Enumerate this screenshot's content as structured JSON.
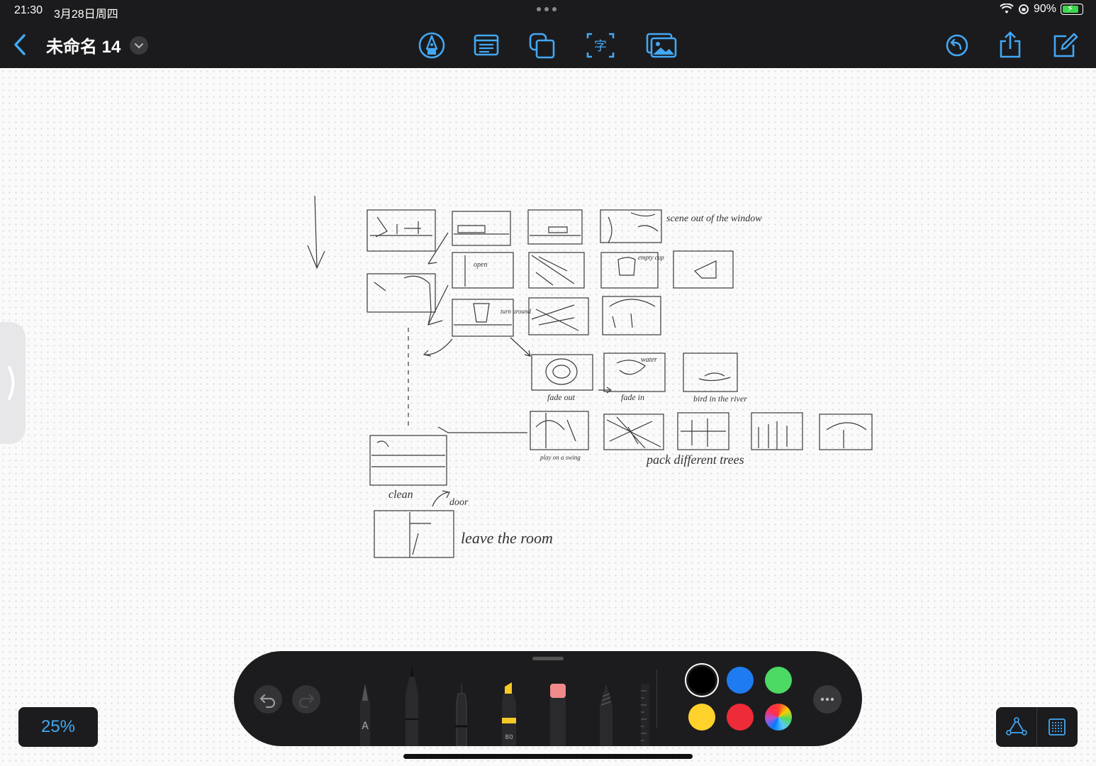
{
  "status_bar": {
    "time": "21:30",
    "date": "3月28日周四",
    "battery": "90%"
  },
  "app_bar": {
    "title": "未命名 14",
    "tools": [
      "pen-tool-icon",
      "text-box-icon",
      "shape-icon",
      "text-recognize-icon",
      "image-icon"
    ],
    "right": [
      "undo-history-icon",
      "share-icon",
      "new-note-icon"
    ]
  },
  "canvas": {
    "sketch_labels": {
      "scene": "scene out of the window",
      "open": "open",
      "empty_cup": "empty cup",
      "turn_around": "turn around",
      "fade_out": "fade out",
      "fade_in": "fade in",
      "water": "water",
      "bird": "bird in the river",
      "swing": "play on a swing",
      "trees": "pack different trees",
      "clean": "clean",
      "door": "door",
      "leave": "leave the room"
    }
  },
  "palette": {
    "tools": [
      "fountain-pen",
      "pencil",
      "fineliner",
      "highlighter",
      "eraser",
      "brush",
      "ruler"
    ],
    "highlighter_size": "80",
    "colors": [
      "#000000",
      "#1e7bf2",
      "#4cd964",
      "#fed22b",
      "#ee2b38",
      "rainbow"
    ]
  },
  "zoom": "25%"
}
